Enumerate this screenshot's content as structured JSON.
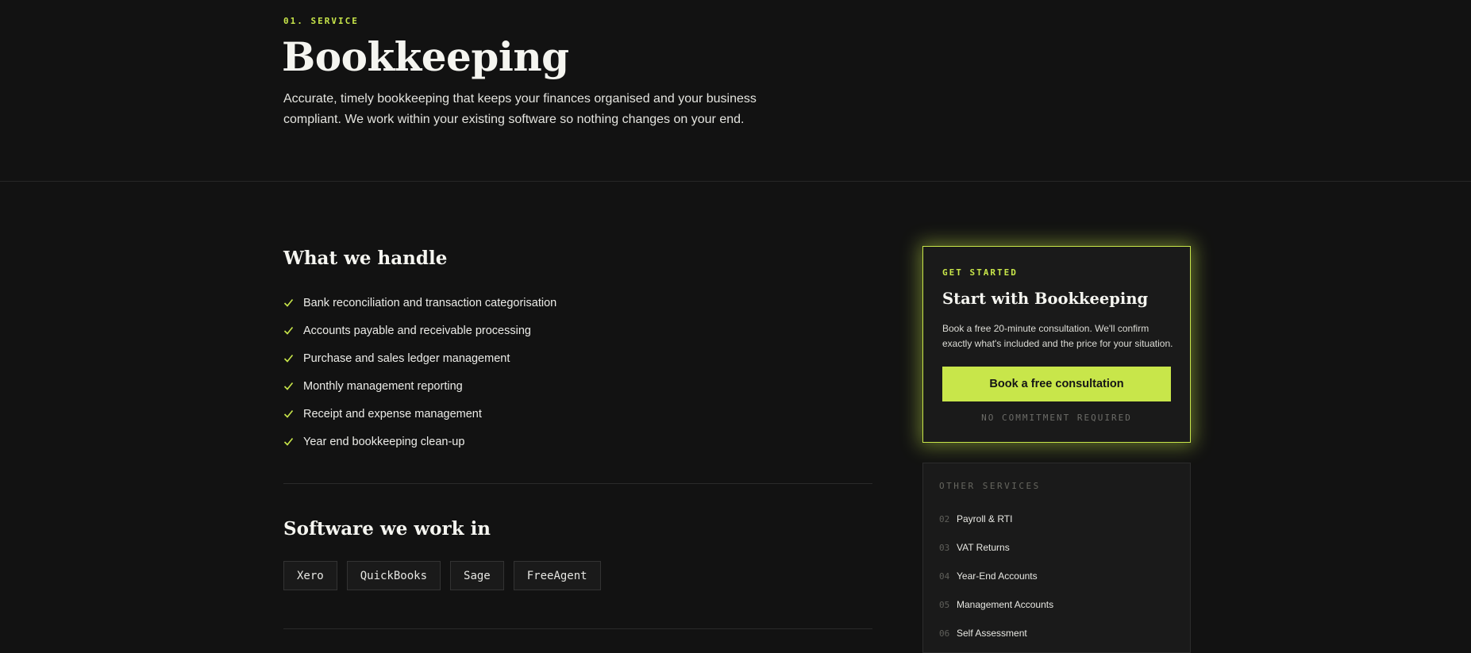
{
  "hero": {
    "eyebrow": "01. SERVICE",
    "title": "Bookkeeping",
    "intro": "Accurate, timely bookkeeping that keeps your finances organised and your business compliant. We work within your existing software so nothing changes on your end."
  },
  "handle": {
    "title": "What we handle",
    "items": [
      "Bank reconciliation and transaction categorisation",
      "Accounts payable and receivable processing",
      "Purchase and sales ledger management",
      "Monthly management reporting",
      "Receipt and expense management",
      "Year end bookkeeping clean-up"
    ]
  },
  "software": {
    "title": "Software we work in",
    "chips": [
      "Xero",
      "QuickBooks",
      "Sage",
      "FreeAgent"
    ]
  },
  "cta": {
    "eyebrow": "GET STARTED",
    "title": "Start with Bookkeeping",
    "text": "Book a free 20-minute consultation. We'll confirm exactly what's included and the price for your situation.",
    "button_label": "Book a free consultation",
    "note": "NO COMMITMENT REQUIRED"
  },
  "other_services": {
    "title": "OTHER SERVICES",
    "items": [
      {
        "num": "02",
        "label": "Payroll & RTI"
      },
      {
        "num": "03",
        "label": "VAT Returns"
      },
      {
        "num": "04",
        "label": "Year-End Accounts"
      },
      {
        "num": "05",
        "label": "Management Accounts"
      },
      {
        "num": "06",
        "label": "Self Assessment"
      }
    ]
  },
  "icons": {
    "check": "check-icon"
  },
  "colors": {
    "accent": "#c8e64a",
    "background": "#121212",
    "card": "#1a1a1a"
  }
}
